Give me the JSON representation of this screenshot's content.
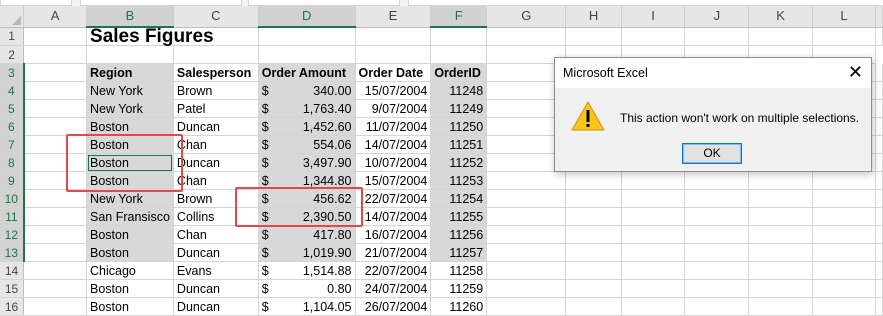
{
  "spreadsheet": {
    "columns": [
      "A",
      "B",
      "C",
      "D",
      "E",
      "F",
      "G",
      "H",
      "I",
      "J",
      "K",
      "L"
    ],
    "selected_columns": [
      "B",
      "D",
      "F"
    ],
    "title": "Sales Figures",
    "headers": [
      "Region",
      "Salesperson",
      "Order Amount",
      "Order Date",
      "OrderID"
    ],
    "rows": [
      {
        "row": "4",
        "region": "New York",
        "salesperson": "Brown",
        "currency": "$",
        "amount": "340.00",
        "date": "15/07/2004",
        "id": "11248"
      },
      {
        "row": "5",
        "region": "New York",
        "salesperson": "Patel",
        "currency": "$",
        "amount": "1,763.40",
        "date": "9/07/2004",
        "id": "11249"
      },
      {
        "row": "6",
        "region": "Boston",
        "salesperson": "Duncan",
        "currency": "$",
        "amount": "1,452.60",
        "date": "11/07/2004",
        "id": "11250"
      },
      {
        "row": "7",
        "region": "Boston",
        "salesperson": "Chan",
        "currency": "$",
        "amount": "554.06",
        "date": "14/07/2004",
        "id": "11251"
      },
      {
        "row": "8",
        "region": "Boston",
        "salesperson": "Duncan",
        "currency": "$",
        "amount": "3,497.90",
        "date": "10/07/2004",
        "id": "11252"
      },
      {
        "row": "9",
        "region": "Boston",
        "salesperson": "Chan",
        "currency": "$",
        "amount": "1,344.80",
        "date": "15/07/2004",
        "id": "11253"
      },
      {
        "row": "10",
        "region": "New York",
        "salesperson": "Brown",
        "currency": "$",
        "amount": "456.62",
        "date": "22/07/2004",
        "id": "11254"
      },
      {
        "row": "11",
        "region": "San Fransisco",
        "salesperson": "Collins",
        "currency": "$",
        "amount": "2,390.50",
        "date": "14/07/2004",
        "id": "11255"
      },
      {
        "row": "12",
        "region": "Boston",
        "salesperson": "Chan",
        "currency": "$",
        "amount": "417.80",
        "date": "16/07/2004",
        "id": "11256"
      },
      {
        "row": "13",
        "region": "Boston",
        "salesperson": "Duncan",
        "currency": "$",
        "amount": "1,019.90",
        "date": "21/07/2004",
        "id": "11257"
      },
      {
        "row": "14",
        "region": "Chicago",
        "salesperson": "Evans",
        "currency": "$",
        "amount": "1,514.88",
        "date": "22/07/2004",
        "id": "11258"
      },
      {
        "row": "15",
        "region": "Boston",
        "salesperson": "Duncan",
        "currency": "$",
        "amount": "0.80",
        "date": "24/07/2004",
        "id": "11259"
      },
      {
        "row": "16",
        "region": "Boston",
        "salesperson": "Duncan",
        "currency": "$",
        "amount": "1,104.05",
        "date": "26/07/2004",
        "id": "11260"
      }
    ]
  },
  "dialog": {
    "title": "Microsoft Excel",
    "close_glyph": "✕",
    "message": "This action won't work on multiple selections.",
    "ok_label": "OK",
    "icon": "warning-icon"
  },
  "colors": {
    "selection_accent": "#217346",
    "annotation_red": "#e04a4a",
    "warning_yellow": "#f7c51c"
  }
}
